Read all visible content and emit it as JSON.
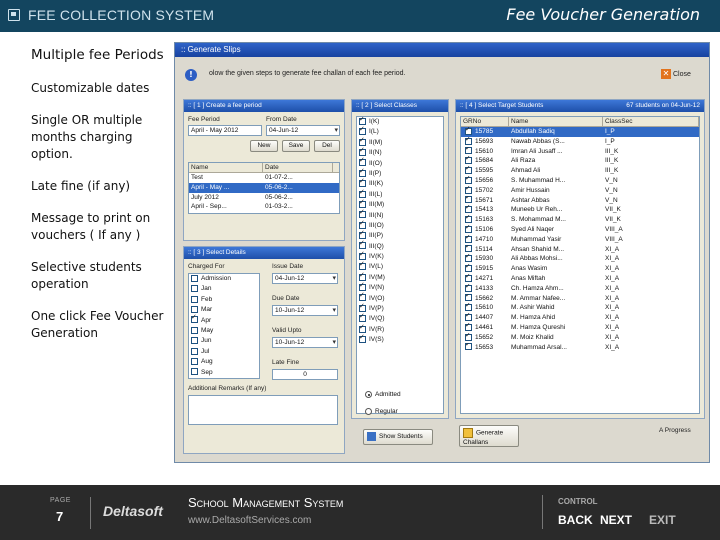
{
  "header": {
    "title": "FEE COLLECTION SYSTEM",
    "subtitle": "Fee Voucher Generation",
    "icon": "save-icon"
  },
  "features": [
    "Multiple fee Periods",
    "Customizable dates",
    "Single OR multiple months charging option.",
    "Late fine (if any)",
    "Message to print on vouchers ( If any )",
    "Selective students operation",
    "One click Fee Voucher Generation"
  ],
  "window": {
    "title": ":: Generate Slips",
    "info": "olow the given steps to generate fee challan of each fee period.",
    "close_label": "Close",
    "period_panel": {
      "title": ":: [ 1 ] Create a fee period",
      "fee_period_label": "Fee Period",
      "fee_period_value": "April - May 2012",
      "from_date_label": "From Date",
      "from_date_value": "04-Jun-12",
      "new_label": "New",
      "save_label": "Save",
      "del_label": "Del",
      "columns": [
        "Name",
        "Date"
      ],
      "rows": [
        {
          "name": "Test",
          "date": "01-07-2..."
        },
        {
          "name": "April - May ...",
          "date": "05-06-2..."
        },
        {
          "name": "July 2012",
          "date": "05-06-2..."
        },
        {
          "name": "April - Sep...",
          "date": "01-03-2..."
        }
      ]
    },
    "classes_panel": {
      "title": ":: [ 2 ] Select Classes",
      "items": [
        "I(K)",
        "I(L)",
        "II(M)",
        "II(N)",
        "II(O)",
        "II(P)",
        "III(K)",
        "III(L)",
        "III(M)",
        "III(N)",
        "III(O)",
        "III(P)",
        "III(Q)",
        "IV(K)",
        "IV(L)",
        "IV(M)",
        "IV(N)",
        "IV(O)",
        "IV(P)",
        "IV(Q)",
        "IV(R)",
        "IV(S)"
      ]
    },
    "students_panel": {
      "title": ":: [ 4 ] Select Target Students",
      "count_text": "67 students on 04-Jun-12",
      "columns": [
        "GRNo",
        "Name",
        "ClassSec"
      ],
      "rows": [
        {
          "gr": "15785",
          "name": "Abdullah Sadiq",
          "cls": "I_P"
        },
        {
          "gr": "15693",
          "name": "Nawab Abbas (S...",
          "cls": "I_P"
        },
        {
          "gr": "15610",
          "name": "Imran Ali Jusaff ...",
          "cls": "III_K"
        },
        {
          "gr": "15684",
          "name": "Ali Raza",
          "cls": "III_K"
        },
        {
          "gr": "15595",
          "name": "Ahmad Ali",
          "cls": "III_K"
        },
        {
          "gr": "15656",
          "name": "S. Muhammad H...",
          "cls": "V_N"
        },
        {
          "gr": "15702",
          "name": "Amir Hussain",
          "cls": "V_N"
        },
        {
          "gr": "15671",
          "name": "Ashtar Abbas",
          "cls": "V_N"
        },
        {
          "gr": "15413",
          "name": "Muneeb Ur Reh...",
          "cls": "VII_K"
        },
        {
          "gr": "15163",
          "name": "S. Mohammad M...",
          "cls": "VII_K"
        },
        {
          "gr": "15106",
          "name": "Syed Ali Naqer",
          "cls": "VIII_A"
        },
        {
          "gr": "14710",
          "name": "Muhammad Yasir",
          "cls": "VIII_A"
        },
        {
          "gr": "15114",
          "name": "Ahsan Shahid M...",
          "cls": "XI_A"
        },
        {
          "gr": "15930",
          "name": "Ali Abbas Mohsi...",
          "cls": "XI_A"
        },
        {
          "gr": "15915",
          "name": "Anas Wasim",
          "cls": "XI_A"
        },
        {
          "gr": "14271",
          "name": "Anas Miftah",
          "cls": "XI_A"
        },
        {
          "gr": "14133",
          "name": "Ch. Hamza Ahm...",
          "cls": "XI_A"
        },
        {
          "gr": "15662",
          "name": "M. Ammar Nafee...",
          "cls": "XI_A"
        },
        {
          "gr": "15610",
          "name": "M. Ashir Wahid",
          "cls": "XI_A"
        },
        {
          "gr": "14407",
          "name": "M. Hamza Ahid",
          "cls": "XI_A"
        },
        {
          "gr": "14461",
          "name": "M. Hamza Qureshi",
          "cls": "XI_A"
        },
        {
          "gr": "15652",
          "name": "M. Moiz Khalid",
          "cls": "XI_A"
        },
        {
          "gr": "15653",
          "name": "Muhammad Arsal...",
          "cls": "XI_A"
        }
      ],
      "generate_label": "Generate Challans",
      "progress_label": "A Progress"
    },
    "details_panel": {
      "title": ":: [ 3 ] Select Details",
      "charged_for_label": "Charged For",
      "months": [
        {
          "name": "Admission",
          "checked": false
        },
        {
          "name": "Jan",
          "checked": false
        },
        {
          "name": "Feb",
          "checked": false
        },
        {
          "name": "Mar",
          "checked": false
        },
        {
          "name": "Apr",
          "checked": true
        },
        {
          "name": "May",
          "checked": false
        },
        {
          "name": "Jun",
          "checked": false
        },
        {
          "name": "Jul",
          "checked": false
        },
        {
          "name": "Aug",
          "checked": false
        },
        {
          "name": "Sep",
          "checked": false
        }
      ],
      "issue_date_label": "Issue Date",
      "issue_date_value": "04-Jun-12",
      "due_date_label": "Due Date",
      "due_date_value": "10-Jun-12",
      "valid_upto_label": "Valid Upto",
      "valid_upto_value": "10-Jun-12",
      "late_fine_label": "Late Fine",
      "late_fine_value": "0",
      "radio_admitted": "Admitted",
      "radio_regular": "Regular",
      "remarks_label": "Additional Remarks (If any)",
      "show_label": "Show Students"
    }
  },
  "footer": {
    "page_label": "PAGE",
    "page_number": "7",
    "brand": "Deltasoft",
    "system": "School Management System",
    "url": "www.DeltasoftServices.com",
    "control_label": "CONTROL",
    "back": "BACK",
    "next": "NEXT",
    "exit": "EXIT"
  }
}
